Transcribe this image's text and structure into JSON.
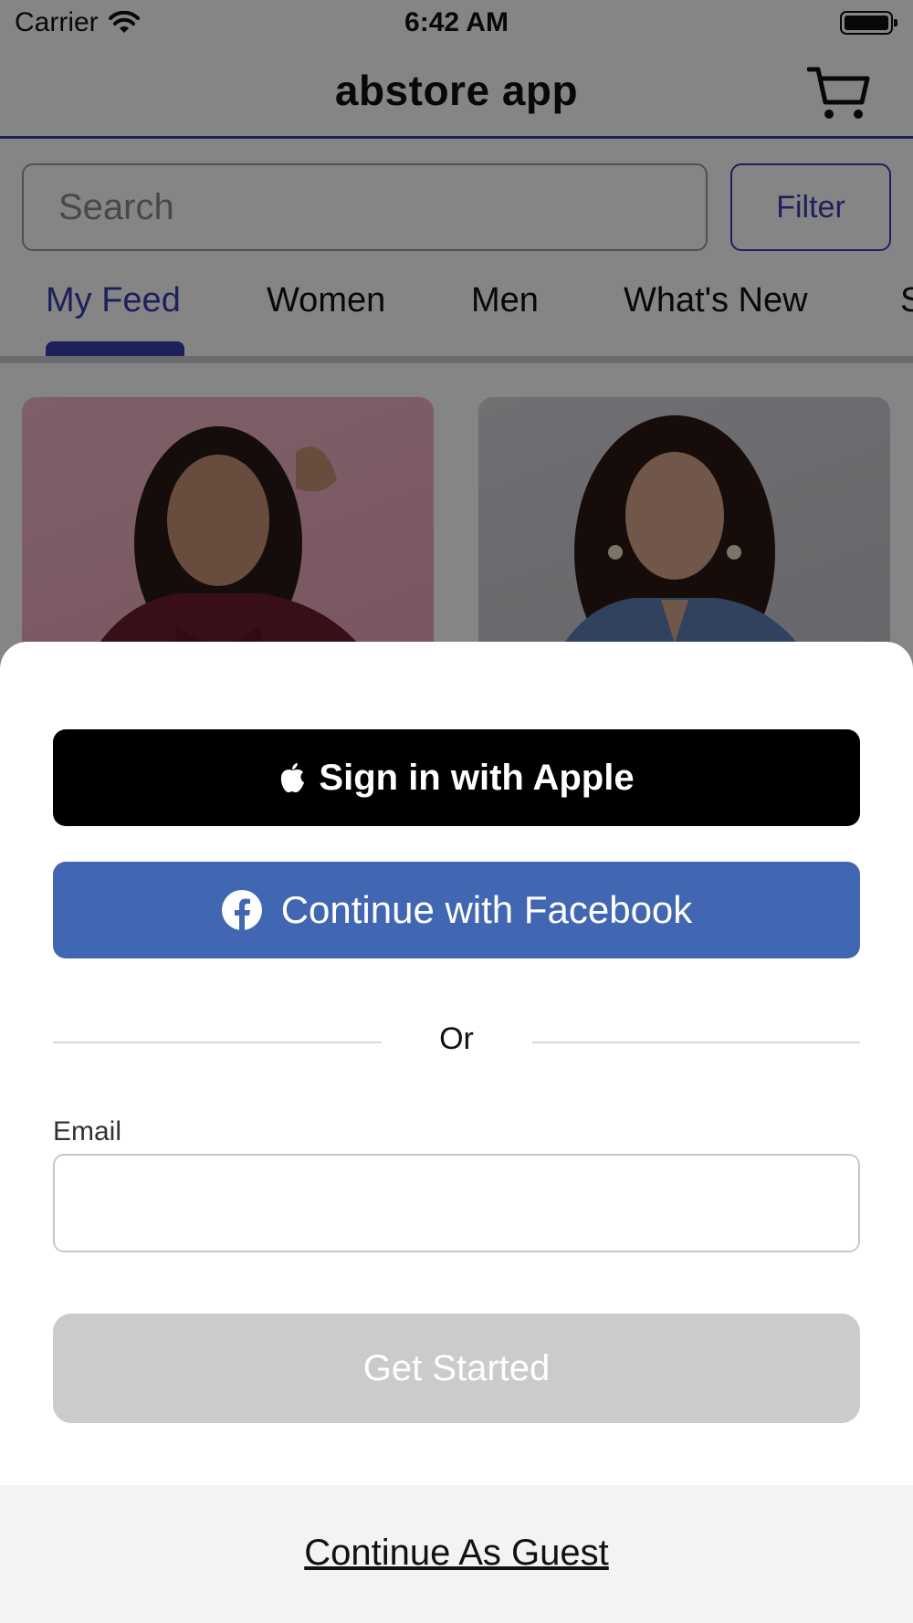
{
  "status_bar": {
    "carrier": "Carrier",
    "time": "6:42 AM"
  },
  "nav": {
    "title": "abstore app",
    "cart_icon": "shopping-cart-icon"
  },
  "search": {
    "placeholder": "Search",
    "value": ""
  },
  "filter": {
    "label": "Filter"
  },
  "tabs": [
    {
      "label": "My Feed",
      "active": true
    },
    {
      "label": "Women",
      "active": false
    },
    {
      "label": "Men",
      "active": false
    },
    {
      "label": "What's New",
      "active": false
    },
    {
      "label": "S",
      "active": false
    }
  ],
  "sheet": {
    "apple_label": "Sign in with Apple",
    "facebook_label": "Continue with Facebook",
    "or_text": "Or",
    "email_label": "Email",
    "email_value": "",
    "get_started_label": "Get Started",
    "guest_label": "Continue As Guest"
  },
  "colors": {
    "accent": "#3b3fb0",
    "facebook": "#4267b2",
    "apple": "#000000",
    "disabled_button": "#cbcbcb"
  }
}
